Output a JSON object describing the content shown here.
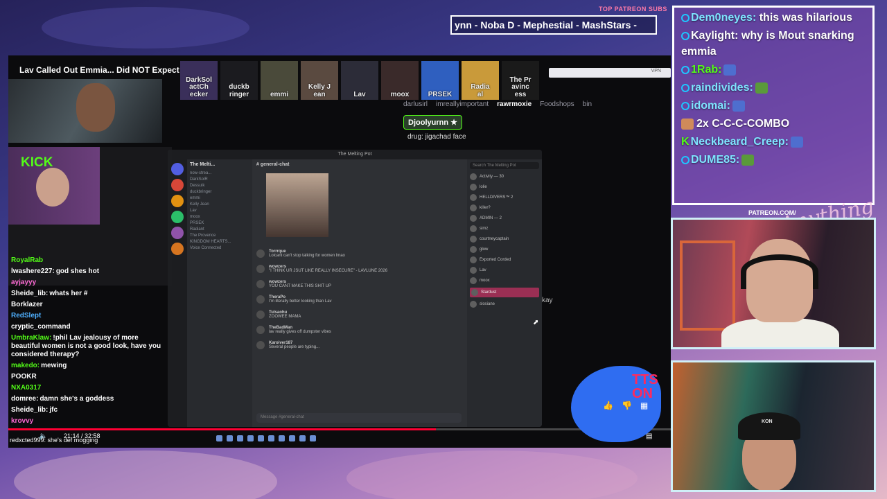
{
  "top_patreon": {
    "label": "TOP PATREON SUBS",
    "ticker": "ynn -  Noba D - Mephestial - MashStars -"
  },
  "stream": {
    "video_title": "Lav Called Out Emmia... Did NOT Expect This 💀",
    "avatars": [
      "DarkSol\nactCh\necker",
      "duckb\nringer",
      "emmi",
      "Kelly J\nean",
      "Lav",
      "moox",
      "PRSEK",
      "Radia\nal",
      "The Pr\navinc\ness"
    ],
    "kick_logo": "KICK",
    "chat_tabs": [
      "darlusirl",
      "imreallyimportant",
      "rawrmoxie",
      "Foodshops",
      "bin"
    ],
    "active_chat_tab": "rawrmoxie",
    "highlight_user": "Djoolyurnn",
    "drug_line": "drug: jigachad face",
    "okay_text": "kay",
    "chat": [
      {
        "user": "RoyalRab",
        "text": "",
        "color": "#53fc18"
      },
      {
        "user": "lwashere227",
        "text": "god shes hot",
        "color": "#ffffff"
      },
      {
        "user": "ayjayyy",
        "text": "",
        "color": "#ff6ad5"
      },
      {
        "user": "Sheide_lib",
        "text": "whats her #",
        "color": "#ffffff"
      },
      {
        "user": "Borklazer",
        "text": "",
        "color": "#ffffff"
      },
      {
        "user": "RedSlept",
        "text": "",
        "color": "#4fb0ff"
      },
      {
        "user": "cryptic_command",
        "text": "",
        "color": "#ffffff"
      },
      {
        "user": "UmbraKlaw",
        "text": "!phil Lav jealousy of more beautiful women is not a good look, have you considered therapy?",
        "color": "#53fc18"
      },
      {
        "user": "makedo",
        "text": "mewing",
        "color": "#53fc18"
      },
      {
        "user": "POOKR",
        "text": "",
        "color": "#ffffff"
      },
      {
        "user": "NXA0317",
        "text": "",
        "color": "#53fc18"
      },
      {
        "user": "domree",
        "text": "damn she's a goddess",
        "color": "#ffffff"
      },
      {
        "user": "Sheide_lib",
        "text": "jfc",
        "color": "#ffffff"
      },
      {
        "user": "krovvy",
        "text": "",
        "color": "#ff6ad5"
      }
    ],
    "bottom_note": "redxcted999: she's def mogging",
    "time": "21:14 / 32:58",
    "progress": 0.645
  },
  "discord": {
    "window_title": "The Melting Pot",
    "guild": "The Melti...",
    "channel": "general-chat",
    "channels": [
      "now-strea...",
      "DarkSolR",
      "Dessuik",
      "duckbringer",
      "emmi",
      "Kelly Jean",
      "Lav",
      "moox",
      "PRSEK",
      "Radiant",
      "The Provence",
      "KINGDOM HEARTS...",
      "Voice Connected"
    ],
    "search_placeholder": "Search The Melting Pot",
    "messages": [
      {
        "name": "Torrrque",
        "text": "Lolcant can't stop talking for women lmao"
      },
      {
        "name": "wowzers",
        "text": "\"I THINK UR JSUT LIKE REALLY INSECURE\" - LAVLUNE 2026"
      },
      {
        "name": "wowzers",
        "text": "YOU CANT MAKE THIS SHIT UP"
      },
      {
        "name": "TheraPo",
        "text": "I'm literally better looking than Lav"
      },
      {
        "name": "Tulsaohu",
        "text": "ZOOWEE MAMA"
      },
      {
        "name": "TheBadMan",
        "text": "lav really gives off dumpster vibes"
      },
      {
        "name": "Karoiver187",
        "text": "Several people are typing..."
      }
    ],
    "input_placeholder": "Message #general-chat",
    "members": [
      "Activity — 30",
      "lolie",
      "HELLDIVERS™ 2",
      "killer?",
      "ADMIN — 2",
      "simz",
      "courtneycaptain",
      "glow",
      "Exported Corded",
      "Lav",
      "moox",
      "Stardust",
      "slosiane"
    ]
  },
  "tts": {
    "label": "TTS\nON"
  },
  "right_chat": {
    "messages": [
      {
        "user": "Dem0neyes",
        "text": "this was hilarious",
        "badge": "circle",
        "user_color": "#7ee4ff"
      },
      {
        "user": "Kaylight",
        "text": "why is Mout snarking emmia",
        "badge": "circle",
        "user_color": "#ffffff"
      },
      {
        "user": "1Rab",
        "text": "",
        "badge": "circle",
        "user_color": "#53fc18"
      },
      {
        "user": "raindivides",
        "text": "",
        "badge": "circle",
        "user_color": "#7ee4ff"
      },
      {
        "user": "idomai",
        "text": "",
        "badge": "circle",
        "user_color": "#7ee4ff"
      },
      {
        "user": "2x C-C-C-COMBO",
        "text": "",
        "badge": "none",
        "user_color": "#ffffff"
      },
      {
        "user": "Neckbeard_Creep",
        "text": "",
        "badge": "kick",
        "user_color": "#7ee4ff"
      },
      {
        "user": "DUME85",
        "text": "",
        "badge": "circle",
        "user_color": "#7ee4ff"
      }
    ]
  },
  "patreon_link": "PATREON.COM/",
  "signature": "Anything Else"
}
